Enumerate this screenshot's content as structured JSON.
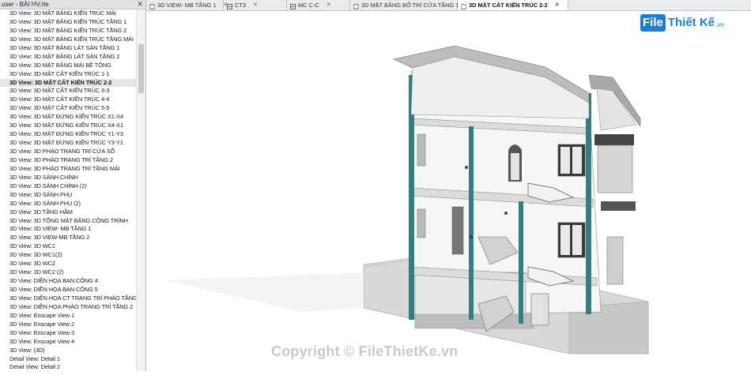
{
  "browser": {
    "title": "user - BÀI HV.rte",
    "close_icon": "close-icon",
    "items": [
      "3D View: 3D MẶT BẰNG KIẾN TRÚC MÁI",
      "3D View: 3D MẶT BẰNG KIẾN TRÚC TẦNG 1",
      "3D View: 3D MẶT BẰNG KIẾN TRÚC TẦNG 2",
      "3D View: 3D MẶT BẰNG KIẾN TRÚC TẦNG MÁI",
      "3D View: 3D MẶT BẰNG LÁT SÀN TẦNG 1",
      "3D View: 3D MẶT BẰNG LÁT SÀN TẦNG 2",
      "3D View: 3D MẶT BẰNG MÁI BÊ TÔNG",
      "3D View: 3D MẶT CẮT KIẾN TRÚC 1-1",
      "3D View: 3D MẶT CẮT KIẾN TRÚC 2-2",
      "3D View: 3D MẶT CẮT KIẾN TRÚC 3-3",
      "3D View: 3D MẶT CẮT KIẾN TRÚC 4-4",
      "3D View: 3D MẶT CẮT KIẾN TRÚC 5-5",
      "3D View: 3D MẶT ĐỨNG KIẾN TRÚC X1-X4",
      "3D View: 3D MẶT ĐỨNG KIẾN TRÚC X4-X1",
      "3D View: 3D MẶT ĐỨNG KIẾN TRÚC Y1-Y3",
      "3D View: 3D MẶT ĐỨNG KIẾN TRÚC Y3-Y1",
      "3D View: 3D PHÀO TRANG TRÍ CỬA SỔ",
      "3D View: 3D PHÀO TRANG TRÍ TẦNG 2",
      "3D View: 3D PHÀO TRANG TRÍ TẦNG MÁI",
      "3D View: 3D SẢNH CHÍNH",
      "3D View: 3D SẢNH CHÍNH (2)",
      "3D View: 3D SẢNH PHỤ",
      "3D View: 3D SẢNH PHỤ (2)",
      "3D View: 3D TẦNG HẦM",
      "3D View: 3D TỔNG MẶT BẰNG CÔNG TRÌNH",
      "3D View: 3D VIEW- MB TẦNG 1",
      "3D View: 3D VIEW-MB TẦNG 2",
      "3D View: 3D WC1",
      "3D View: 3D WC1(2)",
      "3D View: 3D WC2",
      "3D View: 3D WC2 (2)",
      "3D View: DIỄN HỌA BAN CÔNG 4",
      "3D View: DIỄN HỌA BAN CÔNG 5",
      "3D View: DIỄN HỌA CT TRANG TRÍ PHÀO TẦNG MÁI",
      "3D View: DIỄN HỌA PHÀO TRANG TRÍ TẦNG 2",
      "3D View: Enscape View 1",
      "3D View: Enscape View 2",
      "3D View: Enscape View 3",
      "3D View: Enscape View 4",
      "3D View: {3D}",
      "Detail View: Detail 1",
      "Detail View: Detail 2"
    ],
    "selected_index": 8
  },
  "tabs": [
    {
      "label": "3D VIEW- MB TẦNG 1",
      "icon": "3d-view-icon",
      "active": false
    },
    {
      "label": "CT3",
      "icon": "section-view-icon",
      "active": false
    },
    {
      "label": "MC C-C",
      "icon": "section-view-icon",
      "active": false
    },
    {
      "label": "3D MẶT BẰNG BỐ TRÍ CỬA TẦNG 1",
      "icon": "3d-view-icon",
      "active": false
    },
    {
      "label": "3D MẶT CẮT KIẾN TRÚC 2-2",
      "icon": "3d-view-icon",
      "active": true
    }
  ],
  "watermark": {
    "logo_mark": "File",
    "logo_text": "Thiết Kế",
    "logo_domain": ".vn",
    "copyright": "Copyright © FileThietKe.vn"
  },
  "colors": {
    "wall_cut": "#2f7f86",
    "ground": "#d8d8d8",
    "tab_active": "#ffffff",
    "brand": "#1d7fd1"
  }
}
